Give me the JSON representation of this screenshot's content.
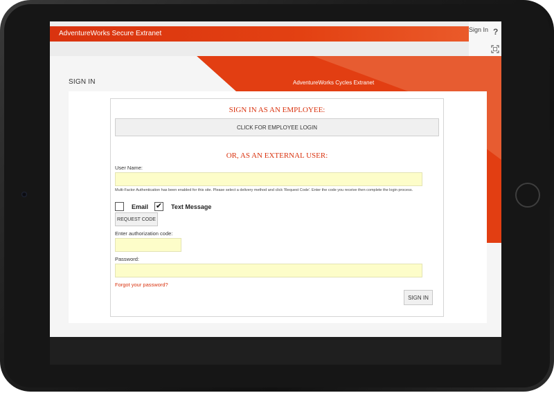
{
  "header": {
    "title": "AdventureWorks Secure Extranet",
    "signin_link": "Sign In",
    "help_glyph": "?"
  },
  "page": {
    "heading": "SIGN IN",
    "site_subtitle": "AdventureWorks Cycles Extranet"
  },
  "employee": {
    "heading": "SIGN IN AS AN EMPLOYEE:",
    "button_label": "CLICK FOR EMPLOYEE LOGIN"
  },
  "external": {
    "heading": "OR, AS AN EXTERNAL USER:",
    "username_label": "User Name:",
    "username_value": "",
    "mfa_note": "Multi-Factor Authentication has been enabled for this site. Please select a delivery method and click 'Request Code'. Enter the code you receive then complete the login process.",
    "email_label": "Email",
    "email_checked": false,
    "text_label": "Text Message",
    "text_checked": true,
    "check_glyph": "✔",
    "request_button": "REQUEST CODE",
    "auth_label": "Enter authorization code:",
    "auth_value": "",
    "password_label": "Password:",
    "password_value": "",
    "forgot_link": "Forgot your password?",
    "signin_button": "SIGN IN"
  },
  "colors": {
    "accent": "#d9330f",
    "input_bg": "#fdfdc9"
  },
  "icons": {
    "help": "help-icon",
    "expand": "expand-icon"
  }
}
